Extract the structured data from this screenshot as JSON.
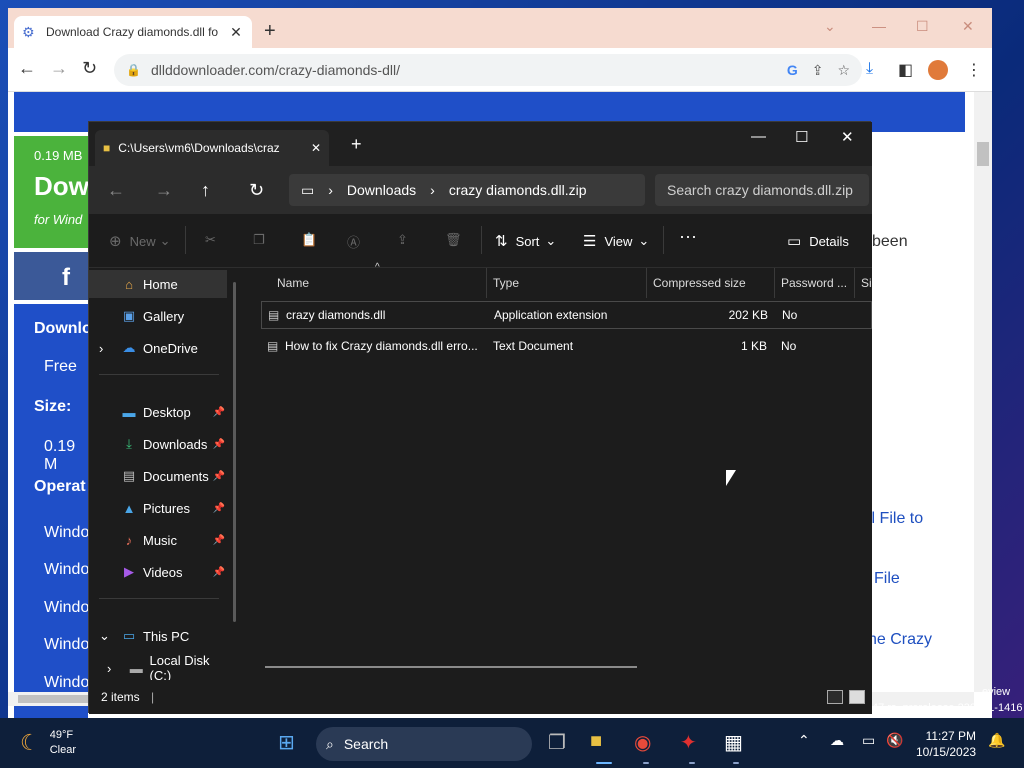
{
  "browser": {
    "tab_title": "Download Crazy diamonds.dll fo",
    "url": "dllddownloader.com/crazy-diamonds-dll/"
  },
  "webpage": {
    "size_small": "0.19 MB",
    "download_big": "Dow",
    "for_windows": "for Wind",
    "fb": "f",
    "download_label": "Downlo",
    "free": "Free",
    "size_label": "Size:",
    "size_value": "0.19 M",
    "operating": "Operat",
    "os_items": [
      "Windo",
      "Windo",
      "Windo",
      "Windo",
      "Windo"
    ],
    "right_been": "been",
    "right_link1": "ll File to",
    "right_link2": "File",
    "right_link3": "he Crazy"
  },
  "explorer": {
    "tab_title": "C:\\Users\\vm6\\Downloads\\craz",
    "breadcrumb": [
      "Downloads",
      "crazy diamonds.dll.zip"
    ],
    "search_placeholder": "Search crazy diamonds.dll.zip",
    "commands": {
      "new": "New",
      "sort": "Sort",
      "view": "View",
      "details": "Details"
    },
    "nav": [
      {
        "label": "Home",
        "icon": "home-icon",
        "selected": true
      },
      {
        "label": "Gallery",
        "icon": "gallery-icon"
      },
      {
        "label": "OneDrive",
        "icon": "cloud-icon"
      },
      {
        "label": "Desktop",
        "icon": "desktop-icon",
        "pinned": true
      },
      {
        "label": "Downloads",
        "icon": "download-icon",
        "pinned": true
      },
      {
        "label": "Documents",
        "icon": "documents-icon",
        "pinned": true
      },
      {
        "label": "Pictures",
        "icon": "pictures-icon",
        "pinned": true
      },
      {
        "label": "Music",
        "icon": "music-icon",
        "pinned": true
      },
      {
        "label": "Videos",
        "icon": "videos-icon",
        "pinned": true
      },
      {
        "label": "This PC",
        "icon": "pc-icon"
      },
      {
        "label": "Local Disk (C:)",
        "icon": "drive-icon"
      }
    ],
    "columns": [
      "Name",
      "Type",
      "Compressed size",
      "Password ...",
      "Si"
    ],
    "files": [
      {
        "name": "crazy diamonds.dll",
        "type": "Application extension",
        "size": "202 KB",
        "password": "No"
      },
      {
        "name": "How to fix Crazy diamonds.dll erro...",
        "type": "Text Document",
        "size": "1 KB",
        "password": "No"
      }
    ],
    "status": "2 items"
  },
  "taskbar": {
    "temp": "49°F",
    "condition": "Clear",
    "search": "Search",
    "time": "11:27 PM",
    "date": "10/15/2023",
    "watermark_1": "eview",
    "watermark_2": "47.rs_prerelease.230901-1416"
  }
}
